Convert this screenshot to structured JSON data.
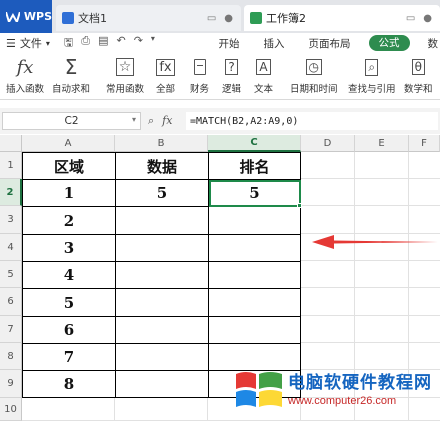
{
  "tabs": {
    "wps": "WPS",
    "doc": "文档1",
    "book": "工作簿2"
  },
  "menu": {
    "file": "文件",
    "tabs": [
      "开始",
      "插入",
      "页面布局",
      "公式",
      "数"
    ],
    "active": "公式"
  },
  "ribbon": {
    "items": [
      "插入函数",
      "自动求和",
      "常用函数",
      "全部",
      "财务",
      "逻辑",
      "文本",
      "日期和时间",
      "查找与引用",
      "数学和"
    ]
  },
  "formula_bar": {
    "cell_ref": "C2",
    "formula": "=MATCH(B2,A2:A9,0)"
  },
  "grid": {
    "columns": [
      "A",
      "B",
      "C",
      "D",
      "E",
      "F"
    ],
    "rows": [
      "1",
      "2",
      "3",
      "4",
      "5",
      "6",
      "7",
      "8",
      "9",
      "10"
    ],
    "active_col": "C",
    "active_row": "2"
  },
  "table": {
    "headers": [
      "区域",
      "数据",
      "排名"
    ],
    "data_value": "5",
    "result_value": "5",
    "regions": [
      "1",
      "2",
      "3",
      "4",
      "5",
      "6",
      "7",
      "8"
    ]
  },
  "watermark": {
    "title": "电脑软硬件教程网",
    "url": "www.computer26.com"
  },
  "colors": {
    "accent": "#2e8c4f",
    "wps_blue": "#1d5bbd",
    "arrow": "#e53935"
  }
}
